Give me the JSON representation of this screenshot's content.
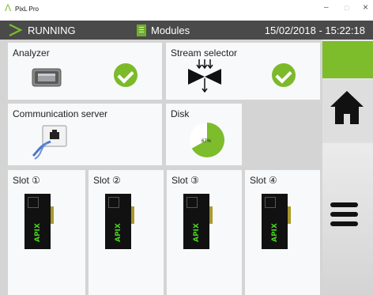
{
  "window": {
    "title": "PixL Pro",
    "minimize": "–",
    "maximize": "□",
    "close": "×"
  },
  "status": {
    "state": "RUNNING",
    "section": "Modules",
    "datetime": "15/02/2018 - 15:22:18"
  },
  "tiles": {
    "analyzer": {
      "label": "Analyzer",
      "status_icon": "check-icon"
    },
    "stream_selector": {
      "label": "Stream selector",
      "status_icon": "check-icon"
    },
    "communication_server": {
      "label": "Communication server"
    },
    "disk": {
      "label": "Disk",
      "usage_label": "67%",
      "usage_fraction": 0.67
    }
  },
  "slots": [
    {
      "label": "Slot ①",
      "module_brand": "APIX"
    },
    {
      "label": "Slot ②",
      "module_brand": "APIX"
    },
    {
      "label": "Slot ③",
      "module_brand": "APIX"
    },
    {
      "label": "Slot ④",
      "module_brand": "APIX"
    }
  ],
  "colors": {
    "accent": "#7cba2a",
    "statusbar": "#4a4a4a",
    "module_text": "#47d51e"
  },
  "sidebar": {
    "items": [
      "active-indicator",
      "home-icon",
      "menu-icon"
    ]
  }
}
